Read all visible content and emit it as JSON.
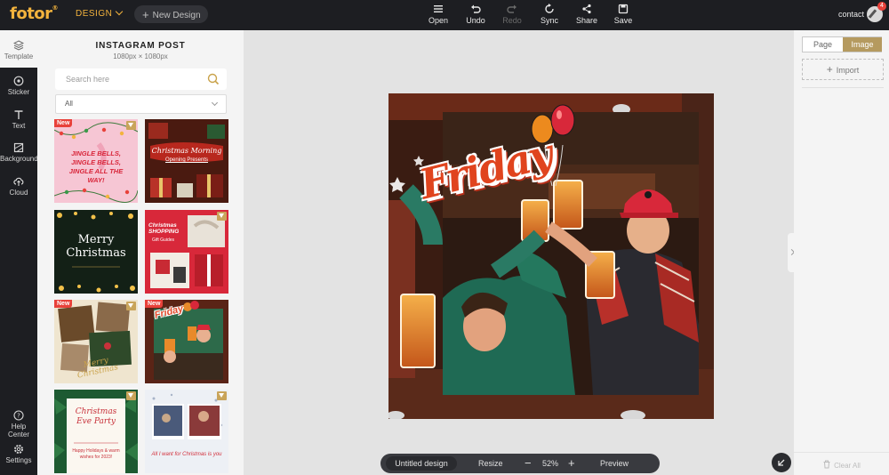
{
  "brand": {
    "logo_text": "fotor"
  },
  "topbar": {
    "design_label": "DESIGN",
    "new_design_label": "New Design",
    "tools": [
      {
        "label": "Open",
        "icon": "menu-icon",
        "enabled": true
      },
      {
        "label": "Undo",
        "icon": "undo-icon",
        "enabled": true
      },
      {
        "label": "Redo",
        "icon": "redo-icon",
        "enabled": false
      },
      {
        "label": "Sync",
        "icon": "sync-icon",
        "enabled": true
      },
      {
        "label": "Share",
        "icon": "share-icon",
        "enabled": true
      },
      {
        "label": "Save",
        "icon": "save-icon",
        "enabled": true
      }
    ],
    "contact_label": "contact",
    "notification_count": "4"
  },
  "rail": {
    "items": [
      {
        "label": "Template",
        "icon": "template-icon",
        "active": true
      },
      {
        "label": "Sticker",
        "icon": "sticker-icon",
        "active": false
      },
      {
        "label": "Text",
        "icon": "text-icon",
        "active": false
      },
      {
        "label": "Background",
        "icon": "background-icon",
        "active": false
      },
      {
        "label": "Cloud",
        "icon": "cloud-icon",
        "active": false
      }
    ],
    "bottom_items": [
      {
        "label": "Help Center",
        "icon": "help-icon"
      },
      {
        "label": "Settings",
        "icon": "settings-icon"
      }
    ]
  },
  "panel": {
    "title": "INSTAGRAM POST",
    "subtitle": "1080px × 1080px",
    "search_placeholder": "Search here",
    "filter_value": "All",
    "new_badge": "New",
    "thumbnails": [
      {
        "text": "JINGLE BELLS, JINGLE BELLS, JINGLE ALL THE WAY!",
        "bg": "#f6c6d4",
        "fg": "#d8263a",
        "new": true,
        "premium": true
      },
      {
        "text": "Christmas Morning",
        "text2": "Opening Presents",
        "bg": "#5a1e12",
        "fg": "#ffffff",
        "new": false,
        "premium": false
      },
      {
        "text": "Merry Christmas",
        "bg": "#0f1a12",
        "fg": "#ffffff",
        "new": false,
        "premium": false
      },
      {
        "text": "Christmas SHOPPING",
        "text2": "Gift Guides",
        "bg": "#d8283a",
        "fg": "#ffffff",
        "new": false,
        "premium": true
      },
      {
        "text": "Merry Christmas",
        "bg": "#f1e7d2",
        "fg": "#c9a24a",
        "new": true,
        "premium": true
      },
      {
        "text": "Friday",
        "bg": "#7a2a1a",
        "fg": "#e04a2a",
        "new": true,
        "premium": false
      },
      {
        "text": "Christmas Eve Party",
        "text2": "Happy Holidays & warm wishes for 2023!",
        "bg": "#1d5a32",
        "fg": "#c8313a",
        "new": false,
        "premium": true
      },
      {
        "text": "All I want for Christmas is you",
        "bg": "#eef1f6",
        "fg": "#d22e3a",
        "new": false,
        "premium": true
      }
    ]
  },
  "canvas": {
    "headline": "Friday"
  },
  "bottombar": {
    "design_name": "Untitled design",
    "resize_label": "Resize",
    "zoom": "52%",
    "preview_label": "Preview"
  },
  "rpanel": {
    "tabs": [
      "Page",
      "Image"
    ],
    "active_tab": "Image",
    "import_label": "Import",
    "clear_all_label": "Clear All"
  },
  "colors": {
    "accent": "#f3b33d",
    "gold": "#b59a5f",
    "dark": "#1d1e22",
    "badge": "#e8413a"
  }
}
